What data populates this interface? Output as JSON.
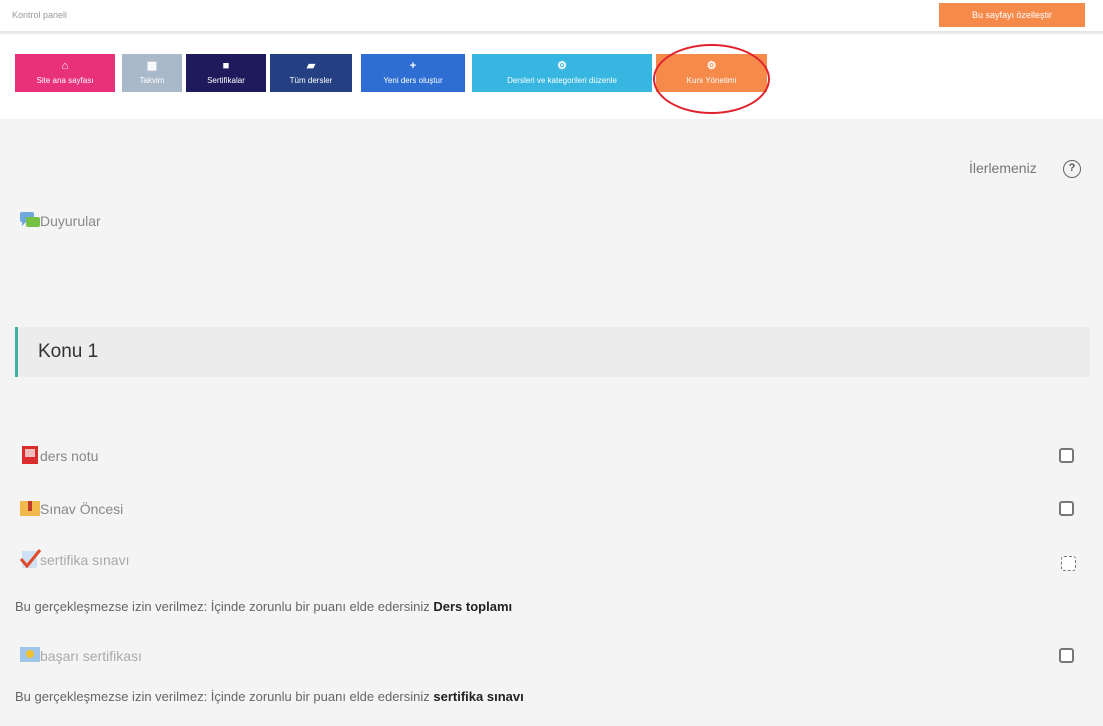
{
  "topbar": {
    "breadcrumb": "Kontrol paneli",
    "customize_label": "Bu sayfayı özelleştir"
  },
  "nav": {
    "buttons": [
      {
        "label": "Site ana sayfası",
        "icon": "home-icon"
      },
      {
        "label": "Takvim",
        "icon": "calendar-icon"
      },
      {
        "label": "Sertifikalar",
        "icon": "bookmark-icon"
      },
      {
        "label": "Tüm dersler",
        "icon": "book-icon"
      },
      {
        "label": "Yeni ders oluştur",
        "icon": "plus-icon"
      },
      {
        "label": "Dersleri ve kategorileri düzenle",
        "icon": "cogs-icon"
      },
      {
        "label": "Kurs Yönetimi",
        "icon": "cogs-icon"
      }
    ]
  },
  "progress": {
    "label": "İlerlemeniz"
  },
  "announcements": {
    "label": "Duyurular"
  },
  "section": {
    "title": "Konu 1"
  },
  "activities": [
    {
      "label": "ders notu",
      "icon": "pdf-icon"
    },
    {
      "label": "Sınav Öncesi",
      "icon": "folder-icon"
    },
    {
      "label": "sertifika sınavı",
      "icon": "quiz-icon"
    },
    {
      "label": "başarı sertifikası",
      "icon": "certificate-icon"
    }
  ],
  "restrictions": [
    {
      "text": "Bu gerçekleşmezse izin verilmez: İçinde zorunlu bir puanı elde edersiniz ",
      "target": "Ders toplamı"
    },
    {
      "text": "Bu gerçekleşmezse izin verilmez: İçinde zorunlu bir puanı elde edersiniz ",
      "target": "sertifika sınavı"
    }
  ]
}
